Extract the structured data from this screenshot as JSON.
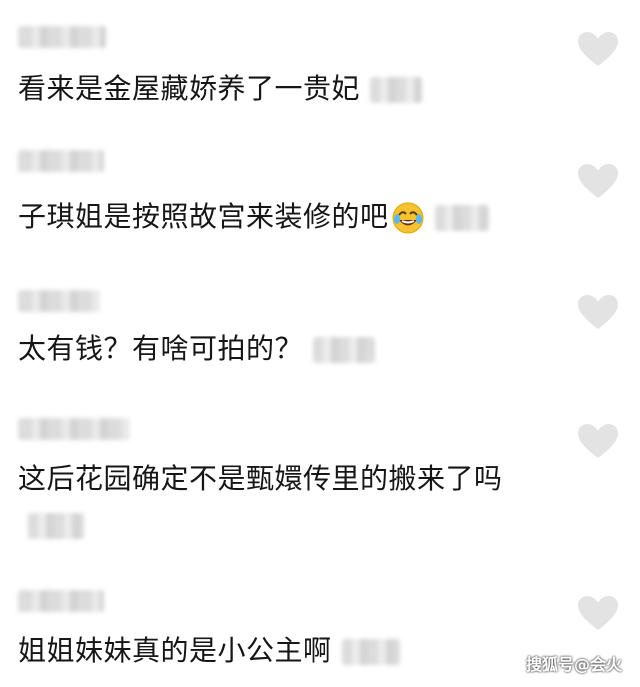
{
  "comments": [
    {
      "text": "看来是金屋藏娇养了一贵妃",
      "has_emoji": false,
      "liked": false
    },
    {
      "text": "子琪姐是按照故宫来装修的吧",
      "has_emoji": true,
      "emoji_name": "rolling-laughing-emoji",
      "liked": false
    },
    {
      "text": "太有钱？有啥可拍的？",
      "has_emoji": false,
      "liked": false
    },
    {
      "text": "这后花园确定不是甄嬛传里的搬来了吗",
      "has_emoji": false,
      "liked": false
    },
    {
      "text": "姐姐妹妹真的是小公主啊",
      "has_emoji": false,
      "liked": false
    }
  ],
  "watermark": "搜狐号@会火",
  "icons": {
    "like": "heart-icon"
  },
  "colors": {
    "heart": "#e3e3e3",
    "text": "#161616"
  }
}
